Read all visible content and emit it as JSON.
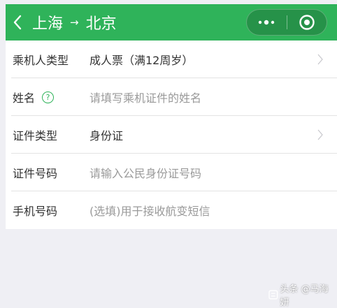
{
  "header": {
    "from_city": "上海",
    "arrow": "→",
    "to_city": "北京",
    "bg_color": "#2fb35a"
  },
  "form": {
    "rows": [
      {
        "label": "乘机人类型",
        "value": "成人票（满12周岁）",
        "placeholder": false,
        "has_chevron": true
      },
      {
        "label": "姓名",
        "value": "请填写乘机证件的姓名",
        "placeholder": true,
        "has_help": true,
        "has_chevron": false
      },
      {
        "label": "证件类型",
        "value": "身份证",
        "placeholder": false,
        "has_chevron": true
      },
      {
        "label": "证件号码",
        "value": "请输入公民身份证号码",
        "placeholder": true,
        "has_chevron": false
      },
      {
        "label": "手机号码",
        "value": "(选填)用于接收航变短信",
        "placeholder": true,
        "has_chevron": false
      }
    ],
    "help_glyph": "?"
  },
  "watermark": {
    "text": "头条 @马海妍"
  }
}
